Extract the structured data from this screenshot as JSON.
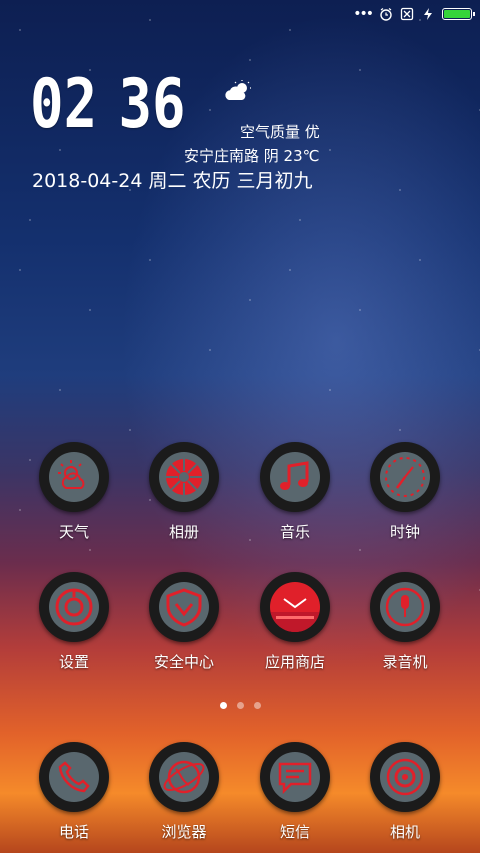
{
  "status_bar": {
    "more_dots": "•••",
    "battery_level": 1.0,
    "battery_color": "#35d43a"
  },
  "clock": {
    "hours": "02",
    "minutes": "36"
  },
  "weather": {
    "icon": "cloud-sun-icon",
    "air_quality": "空气质量 优",
    "location_weather": "安宁庄南路 阴 23℃"
  },
  "date_line": "2018-04-24 周二 农历 三月初九",
  "apps_row1": [
    {
      "label": "天气",
      "icon": "weather-icon"
    },
    {
      "label": "相册",
      "icon": "gallery-icon"
    },
    {
      "label": "音乐",
      "icon": "music-icon"
    },
    {
      "label": "时钟",
      "icon": "clock-icon"
    }
  ],
  "apps_row2": [
    {
      "label": "设置",
      "icon": "settings-icon"
    },
    {
      "label": "安全中心",
      "icon": "security-icon"
    },
    {
      "label": "应用商店",
      "icon": "app-store-icon"
    },
    {
      "label": "录音机",
      "icon": "recorder-icon"
    }
  ],
  "dock": [
    {
      "label": "电话",
      "icon": "phone-icon"
    },
    {
      "label": "浏览器",
      "icon": "browser-icon"
    },
    {
      "label": "短信",
      "icon": "messages-icon"
    },
    {
      "label": "相机",
      "icon": "camera-icon"
    }
  ],
  "pager": {
    "pages": 3,
    "current": 1
  },
  "colors": {
    "icon_accent": "#e0202a",
    "icon_ring": "#1b1b1b",
    "icon_inner": "#59676e"
  }
}
